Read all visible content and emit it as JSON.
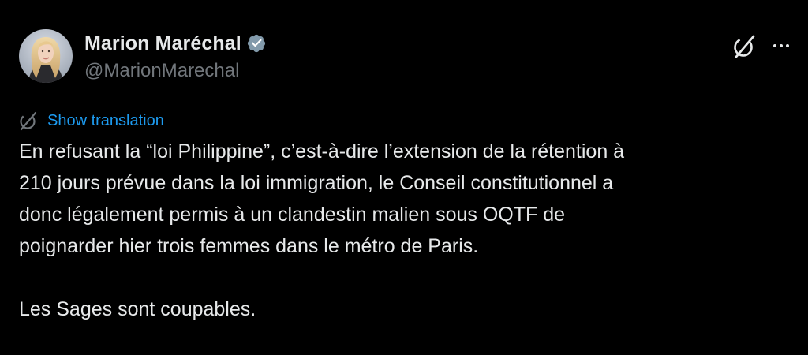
{
  "author": {
    "name": "Marion Maréchal",
    "handle": "@MarionMarechal",
    "verified": true
  },
  "translation": {
    "label": "Show translation"
  },
  "tweet": {
    "text": "En refusant la “loi Philippine”, c’est-à-dire l’extension de la rétention à\n210 jours prévue dans la loi immigration, le Conseil constitutionnel a\ndonc légalement permis à un clandestin malien sous OQTF de\npoignarder hier trois femmes dans le métro de Paris.\n\nLes Sages sont coupables."
  },
  "icons": {
    "verified": "verified-badge-icon",
    "grok": "grok-icon",
    "more": "more-options-icon",
    "translate": "translate-icon"
  },
  "colors": {
    "background": "#000000",
    "text": "#e7e9ea",
    "secondary_text": "#71767b",
    "link": "#1d9bf0",
    "verified_badge": "#829aab"
  }
}
